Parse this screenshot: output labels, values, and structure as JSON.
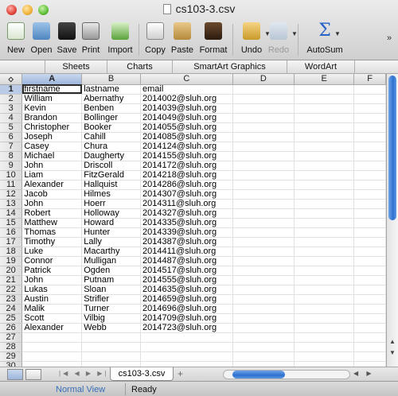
{
  "window": {
    "title": "cs103-3.csv"
  },
  "toolbar": {
    "new": "New",
    "open": "Open",
    "save": "Save",
    "print": "Print",
    "import": "Import",
    "copy": "Copy",
    "paste": "Paste",
    "format": "Format",
    "undo": "Undo",
    "redo": "Redo",
    "autosum": "AutoSum",
    "autosum_symbol": "Σ"
  },
  "ribbon_tabs": [
    "Sheets",
    "Charts",
    "SmartArt Graphics",
    "WordArt"
  ],
  "columns": [
    "A",
    "B",
    "C",
    "D",
    "E",
    "F"
  ],
  "active_cell": "A1",
  "rows": [
    [
      "firstname",
      "lastname",
      "email"
    ],
    [
      "William",
      "Abernathy",
      "2014002@sluh.org"
    ],
    [
      "Kevin",
      "Benben",
      "2014039@sluh.org"
    ],
    [
      "Brandon",
      "Bollinger",
      "2014049@sluh.org"
    ],
    [
      "Christopher",
      "Booker",
      "2014055@sluh.org"
    ],
    [
      "Joseph",
      "Cahill",
      "2014085@sluh.org"
    ],
    [
      "Casey",
      "Chura",
      "2014124@sluh.org"
    ],
    [
      "Michael",
      "Daugherty",
      "2014155@sluh.org"
    ],
    [
      "John",
      "Driscoll",
      "2014172@sluh.org"
    ],
    [
      "Liam",
      "FitzGerald",
      "2014218@sluh.org"
    ],
    [
      "Alexander",
      "Hallquist",
      "2014286@sluh.org"
    ],
    [
      "Jacob",
      "Hilmes",
      "2014307@sluh.org"
    ],
    [
      "John",
      "Hoerr",
      "2014311@sluh.org"
    ],
    [
      "Robert",
      "Holloway",
      "2014327@sluh.org"
    ],
    [
      "Matthew",
      "Howard",
      "2014335@sluh.org"
    ],
    [
      "Thomas",
      "Hunter",
      "2014339@sluh.org"
    ],
    [
      "Timothy",
      "Lally",
      "2014387@sluh.org"
    ],
    [
      "Luke",
      "Macarthy",
      "2014411@sluh.org"
    ],
    [
      "Connor",
      "Mulligan",
      "2014487@sluh.org"
    ],
    [
      "Patrick",
      "Ogden",
      "2014517@sluh.org"
    ],
    [
      "John",
      "Putnam",
      "2014555@sluh.org"
    ],
    [
      "Lukas",
      "Sloan",
      "2014635@sluh.org"
    ],
    [
      "Austin",
      "Strifler",
      "2014659@sluh.org"
    ],
    [
      "Malik",
      "Turner",
      "2014696@sluh.org"
    ],
    [
      "Scott",
      "Vilbig",
      "2014709@sluh.org"
    ],
    [
      "Alexander",
      "Webb",
      "2014723@sluh.org"
    ],
    [
      "",
      "",
      ""
    ],
    [
      "",
      "",
      ""
    ],
    [
      "",
      "",
      ""
    ],
    [
      "",
      "",
      ""
    ]
  ],
  "sheet_tabs": {
    "active": "cs103-3.csv",
    "add": "+"
  },
  "status": {
    "view": "Normal View",
    "text": "Ready"
  },
  "colors": {
    "accent": "#2e6fd0",
    "selected_header": "#9db6dc"
  }
}
